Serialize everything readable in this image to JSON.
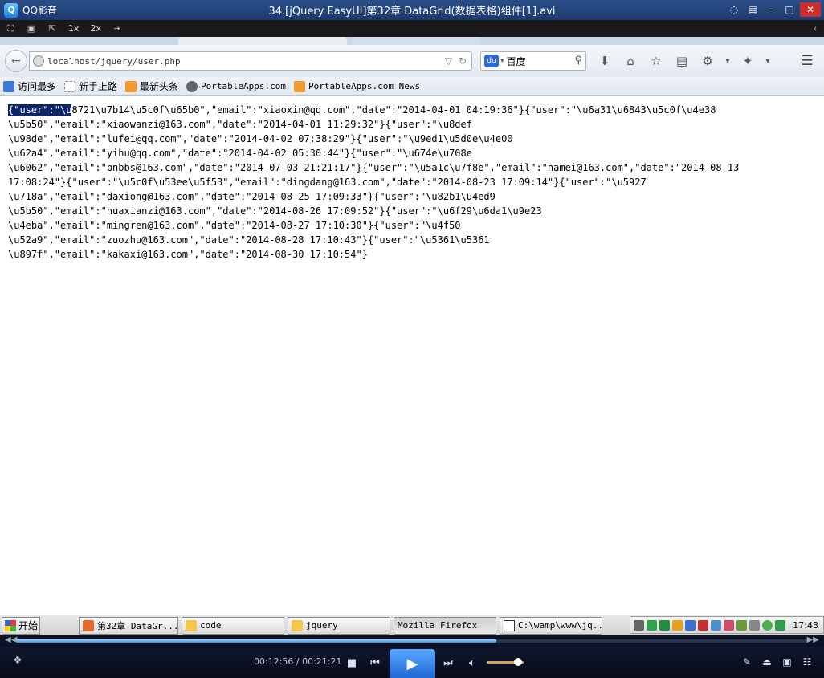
{
  "player": {
    "app_name": "QQ影音",
    "file_title": "34.[jQuery EasyUI]第32章 DataGrid(数据表格)组件[1].avi",
    "zoom_1x": "1x",
    "zoom_2x": "2x",
    "time_display": "00:12:56 / 00:21:21",
    "progress_fraction": 0.606,
    "volume_fraction": 0.85
  },
  "browser": {
    "url": "localhost/jquery/user.php",
    "search_engine": "百度",
    "bookmarks": [
      {
        "label": "访问最多"
      },
      {
        "label": "新手上路"
      },
      {
        "label": "最新头条"
      },
      {
        "label": "PortableApps.com"
      },
      {
        "label": "PortableApps.com News"
      }
    ],
    "content": {
      "selected_text": "{\"user\":\"\\u",
      "first_line_rest": "8721\\u7b14\\u5c0f\\u65b0\",\"email\":\"xiaoxin@qq.com\",\"date\":\"2014-04-01 04:19:36\"}{\"user\":\"\\u6a31\\u6843\\u5c0f\\u4e38",
      "lines": [
        "\\u5b50\",\"email\":\"xiaowanzi@163.com\",\"date\":\"2014-04-01 11:29:32\"}{\"user\":\"\\u8def",
        "\\u98de\",\"email\":\"lufei@qq.com\",\"date\":\"2014-04-02 07:38:29\"}{\"user\":\"\\u9ed1\\u5d0e\\u4e00",
        "\\u62a4\",\"email\":\"yihu@qq.com\",\"date\":\"2014-04-02 05:30:44\"}{\"user\":\"\\u674e\\u708e",
        "\\u6062\",\"email\":\"bnbbs@163.com\",\"date\":\"2014-07-03 21:21:17\"}{\"user\":\"\\u5a1c\\u7f8e\",\"email\":\"namei@163.com\",\"date\":\"2014-08-13",
        "17:08:24\"}{\"user\":\"\\u5c0f\\u53ee\\u5f53\",\"email\":\"dingdang@163.com\",\"date\":\"2014-08-23 17:09:14\"}{\"user\":\"\\u5927",
        "\\u718a\",\"email\":\"daxiong@163.com\",\"date\":\"2014-08-25 17:09:33\"}{\"user\":\"\\u82b1\\u4ed9",
        "\\u5b50\",\"email\":\"huaxianzi@163.com\",\"date\":\"2014-08-26 17:09:52\"}{\"user\":\"\\u6f29\\u6da1\\u9e23",
        "\\u4eba\",\"email\":\"mingren@163.com\",\"date\":\"2014-08-27 17:10:30\"}{\"user\":\"\\u4f50",
        "\\u52a9\",\"email\":\"zuozhu@163.com\",\"date\":\"2014-08-28 17:10:43\"}{\"user\":\"\\u5361\\u5361",
        "\\u897f\",\"email\":\"kakaxi@163.com\",\"date\":\"2014-08-30 17:10:54\"}"
      ]
    }
  },
  "taskbar": {
    "start_label": "开始",
    "tasks": [
      {
        "label": "第32章 DataGr..."
      },
      {
        "label": "code"
      },
      {
        "label": "jquery"
      },
      {
        "label": "Mozilla Firefox"
      },
      {
        "label": "C:\\wamp\\www\\jq..."
      }
    ],
    "clock": "17:43"
  },
  "icons": {
    "back": "back-arrow-icon",
    "reload": "reload-icon",
    "search": "magnifier-icon",
    "download": "download-icon",
    "home": "home-icon",
    "bookmark": "star-icon",
    "menu": "hamburger-icon"
  }
}
